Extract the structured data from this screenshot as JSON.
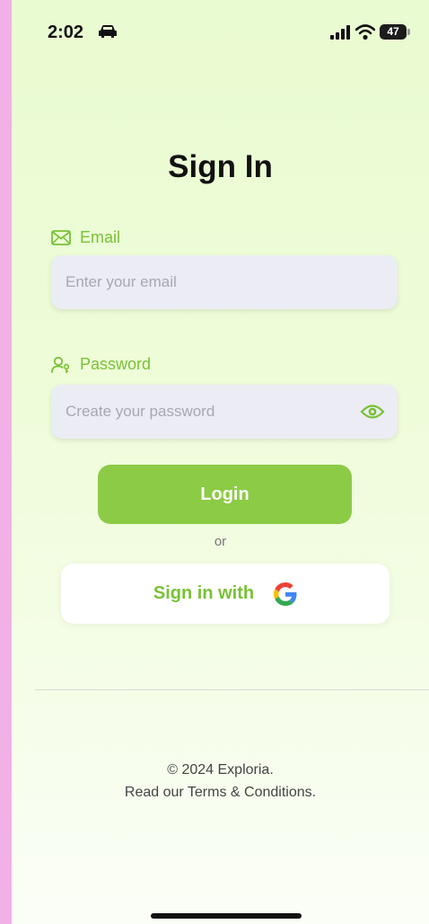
{
  "status_bar": {
    "time": "2:02",
    "battery": "47"
  },
  "title": "Sign In",
  "email": {
    "label": "Email",
    "placeholder": "Enter your email"
  },
  "password": {
    "label": "Password",
    "placeholder": "Create your password"
  },
  "login_button": "Login",
  "or_text": "or",
  "google_button": "Sign in with",
  "footer": {
    "copyright": "© 2024 Exploria.",
    "terms": "Read our Terms & Conditions."
  },
  "colors": {
    "accent": "#8ccb45",
    "label": "#78c236",
    "background": "#eefcd8"
  },
  "icons": [
    "car-icon",
    "signal-icon",
    "wifi-icon",
    "mail-icon",
    "user-key-icon",
    "eye-icon",
    "google-icon"
  ]
}
